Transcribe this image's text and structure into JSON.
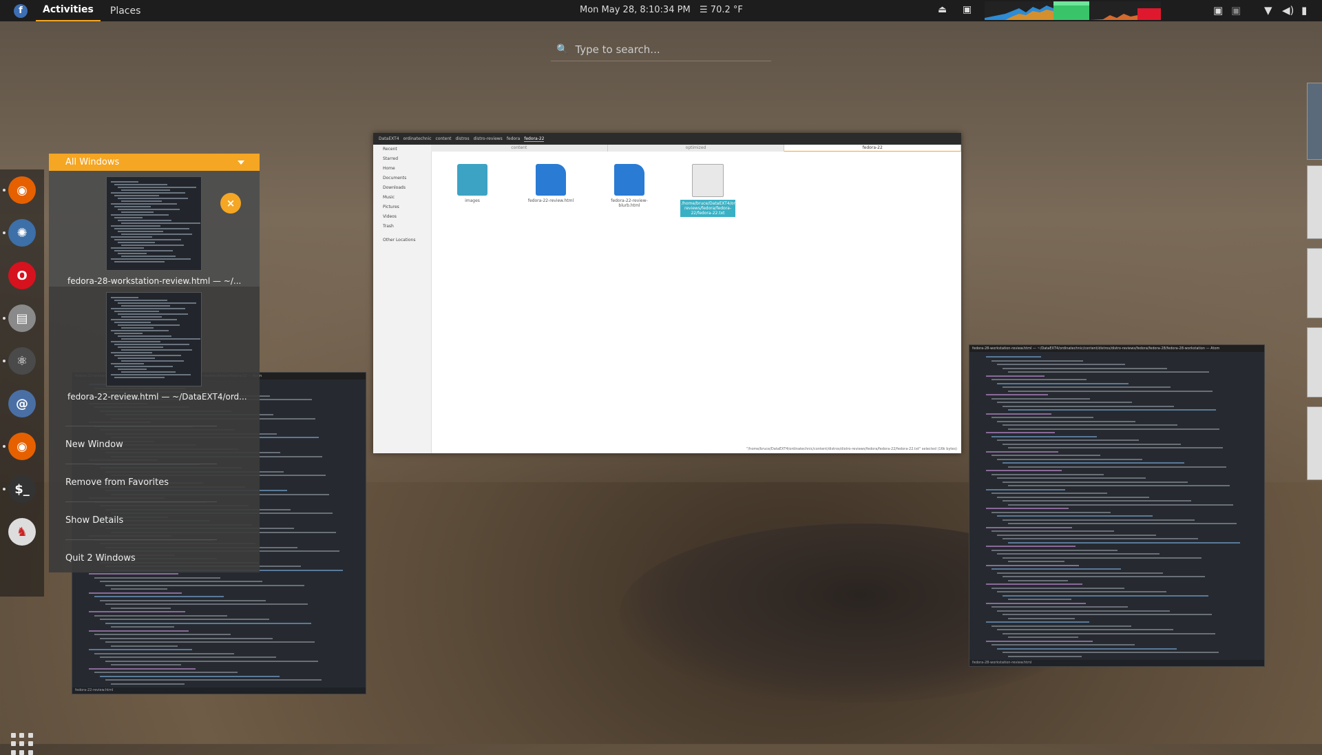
{
  "topbar": {
    "activities": "Activities",
    "places": "Places",
    "clock": "Mon May 28,  8:10:34 PM",
    "weather": "70.2 °F"
  },
  "search": {
    "placeholder": "Type to search..."
  },
  "dash": {
    "apps": [
      {
        "name": "firefox-icon",
        "color": "#e66000",
        "glyph": "◉"
      },
      {
        "name": "settings-icon",
        "color": "#3d6fa8",
        "glyph": "✺"
      },
      {
        "name": "opera-icon",
        "color": "#d6121e",
        "glyph": "O"
      },
      {
        "name": "files-icon",
        "color": "#8a8a8a",
        "glyph": "▤"
      },
      {
        "name": "atom-icon",
        "color": "#4a4a4a",
        "glyph": "⚛"
      },
      {
        "name": "mail-icon",
        "color": "#4a6fa5",
        "glyph": "@"
      },
      {
        "name": "firefox-icon-2",
        "color": "#e66000",
        "glyph": "◉"
      },
      {
        "name": "terminal-icon",
        "color": "#333333",
        "glyph": "$_"
      },
      {
        "name": "java-app-icon",
        "color": "#dddddd",
        "glyph": "♞"
      }
    ]
  },
  "popup": {
    "header": "All Windows",
    "windows": [
      {
        "label": "fedora-28-workstation-review.html — ~/..."
      },
      {
        "label": "fedora-22-review.html — ~/DataEXT4/ord..."
      }
    ],
    "menu": [
      "New Window",
      "Remove from Favorites",
      "Show Details",
      "Quit 2 Windows"
    ]
  },
  "files": {
    "breadcrumbs": [
      "DataEXT4",
      "ordinatechnic",
      "content",
      "distros",
      "distro-reviews",
      "fedora",
      "fedora-22"
    ],
    "sidebar": [
      "Recent",
      "Starred",
      "Home",
      "Documents",
      "Downloads",
      "Music",
      "Pictures",
      "Videos",
      "Trash",
      "Other Locations"
    ],
    "tabs": [
      "content",
      "optimized",
      "fedora-22"
    ],
    "items": [
      {
        "label": "images",
        "kind": "folder"
      },
      {
        "label": "fedora-22-review.html",
        "kind": "web"
      },
      {
        "label": "fedora-22-review-blurb.html",
        "kind": "web"
      },
      {
        "label": "/home/bruce/DataEXT4/ordinatechnic/content/distros/distro-reviews/fedora/fedora-22/fedora-22.txt",
        "kind": "doc"
      }
    ],
    "status": "\"/home/bruce/DataEXT4/ordinatechnic/content/distros/distro-reviews/fedora/fedora-22/fedora-22.txt\" selected (16k bytes)"
  },
  "editor_left": {
    "title": "fedora-22-review.html — ~/DataEXT4/ordinatechnic/content/distros/distro-reviews/fedora/fedora-22 — Atom",
    "status": "fedora-22-review.html"
  },
  "editor_right": {
    "title": "fedora-28-workstation-review.html — ~/DataEXT4/ordinatechnic/content/distros/distro-reviews/fedora/fedora-28/fedora-28-workstation — Atom",
    "status": "fedora-28-workstation-review.html"
  },
  "colors": {
    "accent": "#f5a623",
    "panel": "#1d1d1d"
  }
}
